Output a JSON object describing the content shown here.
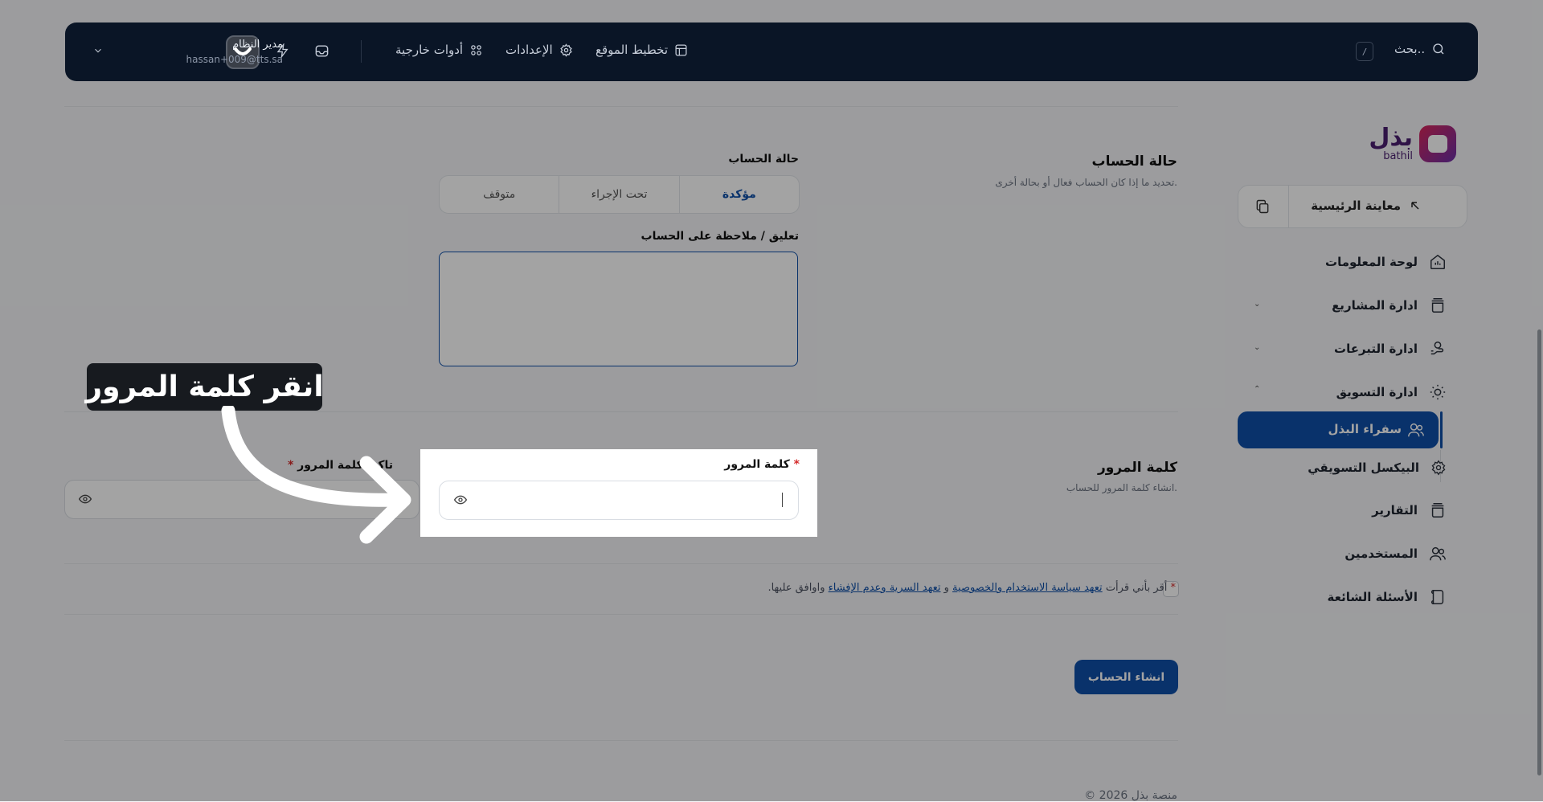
{
  "topbar": {
    "search_placeholder": "بحث..",
    "search_shortcut": "/",
    "nav": [
      {
        "label": "تخطيط الموقع",
        "icon": "layout-icon"
      },
      {
        "label": "الإعدادات",
        "icon": "gear-icon"
      },
      {
        "label": "أدوات خارجية",
        "icon": "grid-icon"
      }
    ],
    "user": {
      "name": "مدير النظام",
      "email": "hassan+009@tts.sa"
    }
  },
  "sidebar": {
    "logo": {
      "ar": "بذل",
      "en": "bathil"
    },
    "preview_label": "معاينة الرئيسية",
    "items": [
      {
        "label": "لوحة المعلومات",
        "icon": "dashboard-icon"
      },
      {
        "label": "ادارة المشاريع",
        "icon": "stack-icon",
        "expandable": true
      },
      {
        "label": "ادارة التبرعات",
        "icon": "donation-icon",
        "expandable": true
      },
      {
        "label": "ادارة التسويق",
        "icon": "sun-icon",
        "expanded": true
      },
      {
        "label": "سفراء البذل",
        "icon": "users-icon",
        "active": true
      },
      {
        "label": "البيكسل التسويقي",
        "icon": "gear-icon"
      },
      {
        "label": "التقارير",
        "icon": "stack-icon"
      },
      {
        "label": "المستخدمين",
        "icon": "users-icon"
      },
      {
        "label": "الأسئلة الشائعة",
        "icon": "faq-icon"
      }
    ]
  },
  "account_status": {
    "title": "حالة الحساب",
    "description": "تحديد ما إذا كان الحساب فعال أو بحالة أخرى.",
    "field_label": "حالة الحساب",
    "options": [
      "مؤكدة",
      "تحت الإجراء",
      "متوقف"
    ],
    "selected": "مؤكدة",
    "comment_label": "تعليق / ملاحظة على الحساب",
    "comment_value": ""
  },
  "password": {
    "title": "كلمة المرور",
    "description": "انشاء كلمة المرور للحساب.",
    "password_label": "كلمة المرور",
    "confirm_label": "تاكيد كلمة المرور",
    "required_mark": "*"
  },
  "terms": {
    "prefix": "أقر بأني قرأت",
    "link1": "تعهد سياسة الاستخدام والخصوصية",
    "and": "و",
    "link2": "تعهد السرية وعدم الإفشاء",
    "suffix": "واوافق عليها."
  },
  "submit_label": "انشاء الحساب",
  "footer_text": "© 2026 منصة بذل",
  "tooltip_text": "انقر كلمة المرور",
  "colors": {
    "primary": "#0f4fa8",
    "topbar": "#0a1526",
    "required": "#d42a2a"
  }
}
